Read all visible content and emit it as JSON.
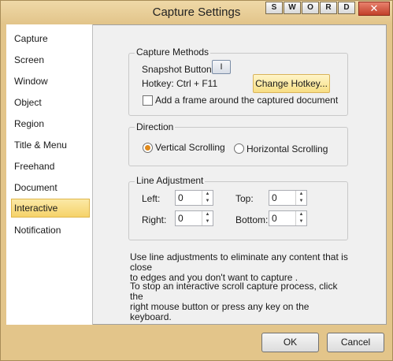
{
  "window": {
    "title": "Capture Settings",
    "badge_letters": [
      "S",
      "W",
      "O",
      "R",
      "D"
    ],
    "close_label": "✕"
  },
  "sidebar": {
    "items": [
      {
        "label": "Capture"
      },
      {
        "label": "Screen"
      },
      {
        "label": "Window"
      },
      {
        "label": "Object"
      },
      {
        "label": "Region"
      },
      {
        "label": "Title & Menu"
      },
      {
        "label": "Freehand"
      },
      {
        "label": "Document"
      },
      {
        "label": "Interactive",
        "selected": true
      },
      {
        "label": "Notification"
      }
    ]
  },
  "capture_methods": {
    "title": "Capture Methods",
    "snapshot_label": "Snapshot Button:",
    "snapshot_button_glyph": "I",
    "hotkey_text": "Hotkey: Ctrl + F11",
    "change_hotkey_label": "Change Hotkey...",
    "frame_checkbox_label": "Add a frame around the captured document",
    "frame_checked": false
  },
  "direction": {
    "title": "Direction",
    "vertical_label": "Vertical Scrolling",
    "horizontal_label": "Horizontal Scrolling",
    "selected": "vertical"
  },
  "line_adjustment": {
    "title": "Line Adjustment",
    "left_label": "Left:",
    "left_value": "0",
    "top_label": "Top:",
    "top_value": "0",
    "right_label": "Right:",
    "right_value": "0",
    "bottom_label": "Bottom:",
    "bottom_value": "0"
  },
  "notes": {
    "note1": "Use line adjustments to eliminate any content that is close\nto edges and you don't want to capture .",
    "note2": "To stop an interactive scroll capture process, click the\nright mouse button or press any key on the keyboard."
  },
  "buttons": {
    "ok": "OK",
    "cancel": "Cancel"
  }
}
